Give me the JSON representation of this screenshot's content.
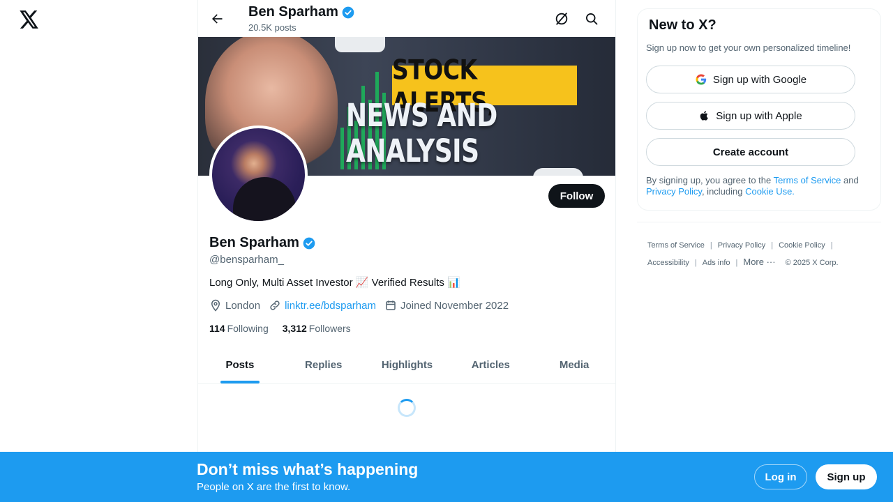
{
  "colors": {
    "accent": "#1d9bf0",
    "text": "#0f1419",
    "muted": "#536471",
    "banner_yellow": "#f6c21c"
  },
  "nav": {
    "logo_icon": "x-logo-icon"
  },
  "header": {
    "name": "Ben Sparham",
    "posts_count": "20.5K posts",
    "back_icon": "arrow-left-icon",
    "grok_icon": "grok-icon",
    "search_icon": "search-icon"
  },
  "banner": {
    "line1": "STOCK ALERTS,",
    "line2": "NEWS AND ANALYSIS"
  },
  "profile": {
    "name": "Ben Sparham",
    "handle": "@bensparham_",
    "bio": "Long Only, Multi Asset Investor 📈 Verified Results 📊",
    "location": "London",
    "website": "linktr.ee/bdsparham",
    "joined": "Joined November 2022",
    "following_count": "114",
    "following_label": "Following",
    "followers_count": "3,312",
    "followers_label": "Followers",
    "follow_label": "Follow"
  },
  "tabs": [
    "Posts",
    "Replies",
    "Highlights",
    "Articles",
    "Media"
  ],
  "active_tab": "Posts",
  "signup_card": {
    "title": "New to X?",
    "subtitle": "Sign up now to get your own personalized timeline!",
    "google_label": "Sign up with Google",
    "apple_label": "Sign up with Apple",
    "create_label": "Create account",
    "legal_prefix": "By signing up, you agree to the ",
    "terms": "Terms of Service",
    "and": " and ",
    "privacy": "Privacy Policy",
    "including": ", including ",
    "cookie": "Cookie Use."
  },
  "footer": {
    "terms": "Terms of Service",
    "privacy": "Privacy Policy",
    "cookie": "Cookie Policy",
    "accessibility": "Accessibility",
    "ads": "Ads info",
    "more": "More ···",
    "copyright": "© 2025 X Corp."
  },
  "bottom_bar": {
    "title": "Don’t miss what’s happening",
    "subtitle": "People on X are the first to know.",
    "login": "Log in",
    "signup": "Sign up"
  }
}
